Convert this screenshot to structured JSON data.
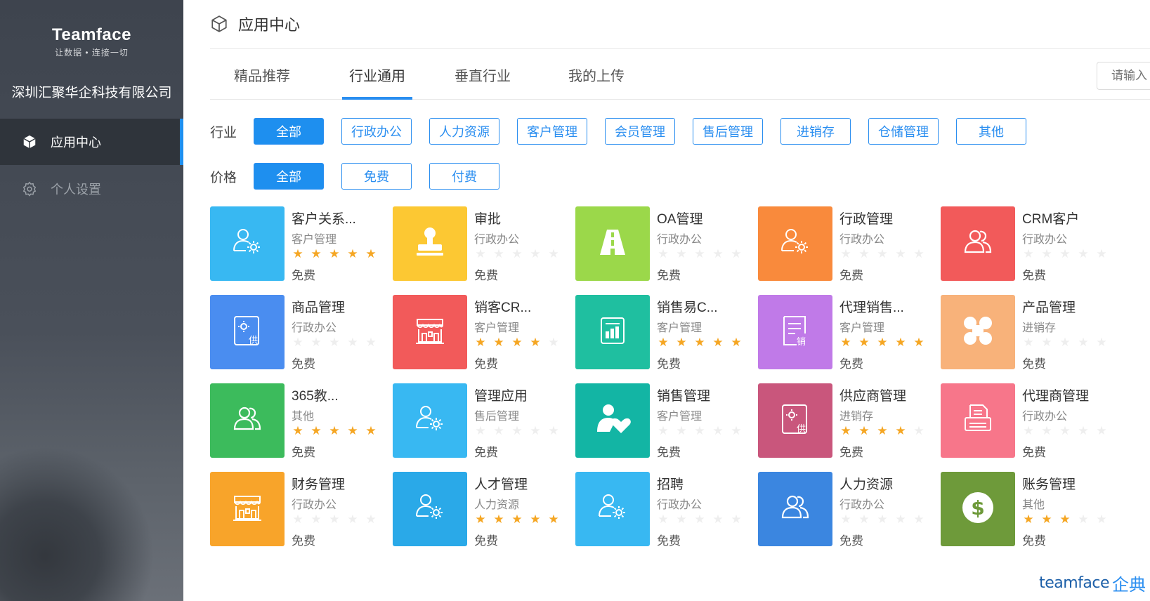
{
  "sidebar": {
    "logo_main": "Teamface",
    "logo_sub": "让数据 • 连接一切",
    "company": "深圳汇聚华企科技有限公司",
    "nav": [
      {
        "label": "应用中心",
        "icon": "cube-icon",
        "active": true
      },
      {
        "label": "个人设置",
        "icon": "gear-icon",
        "active": false
      }
    ]
  },
  "header": {
    "title": "应用中心",
    "icon": "cube-icon"
  },
  "tabs": [
    {
      "label": "精品推荐",
      "active": false
    },
    {
      "label": "行业通用",
      "active": true
    },
    {
      "label": "垂直行业",
      "active": false
    },
    {
      "label": "我的上传",
      "active": false
    }
  ],
  "search": {
    "placeholder": "请输入"
  },
  "filters": {
    "industry": {
      "label": "行业",
      "options": [
        "全部",
        "行政办公",
        "人力资源",
        "客户管理",
        "会员管理",
        "售后管理",
        "进销存",
        "仓储管理",
        "其他"
      ],
      "selected": "全部"
    },
    "price": {
      "label": "价格",
      "options": [
        "全部",
        "免费",
        "付费"
      ],
      "selected": "全部"
    }
  },
  "apps": [
    {
      "name": "客户关系...",
      "category": "客户管理",
      "rating": 5,
      "price": "免费",
      "color": "#38b8f2",
      "icon": "user-gear-icon"
    },
    {
      "name": "审批",
      "category": "行政办公",
      "rating": 0,
      "price": "免费",
      "color": "#fcc833",
      "icon": "stamp-icon"
    },
    {
      "name": "OA管理",
      "category": "行政办公",
      "rating": 0,
      "price": "免费",
      "color": "#9bd84a",
      "icon": "road-icon"
    },
    {
      "name": "行政管理",
      "category": "行政办公",
      "rating": 0,
      "price": "免费",
      "color": "#f98a3c",
      "icon": "user-gear-icon"
    },
    {
      "name": "CRM客户",
      "category": "行政办公",
      "rating": 0,
      "price": "免费",
      "color": "#f25a5a",
      "icon": "users-icon"
    },
    {
      "name": "商品管理",
      "category": "行政办公",
      "rating": 0,
      "price": "免费",
      "color": "#4a8df0",
      "icon": "supply-doc-icon"
    },
    {
      "name": "销客CR...",
      "category": "客户管理",
      "rating": 4,
      "price": "免费",
      "color": "#f25a5a",
      "icon": "store-icon"
    },
    {
      "name": "销售易C...",
      "category": "客户管理",
      "rating": 5,
      "price": "免费",
      "color": "#1fbfa0",
      "icon": "report-icon"
    },
    {
      "name": "代理销售...",
      "category": "客户管理",
      "rating": 5,
      "price": "免费",
      "color": "#c07ae8",
      "icon": "sales-doc-icon"
    },
    {
      "name": "产品管理",
      "category": "进销存",
      "rating": 0,
      "price": "免费",
      "color": "#f8b27a",
      "icon": "clover-icon"
    },
    {
      "name": "365教...",
      "category": "其他",
      "rating": 5,
      "price": "免费",
      "color": "#3cbb5c",
      "icon": "users-icon"
    },
    {
      "name": "管理应用",
      "category": "售后管理",
      "rating": 0,
      "price": "免费",
      "color": "#38b8f2",
      "icon": "user-gear-icon"
    },
    {
      "name": "销售管理",
      "category": "客户管理",
      "rating": 0,
      "price": "免费",
      "color": "#13b5a4",
      "icon": "user-heart-icon"
    },
    {
      "name": "供应商管理",
      "category": "进销存",
      "rating": 4,
      "price": "免费",
      "color": "#c9567c",
      "icon": "supply-doc-icon"
    },
    {
      "name": "代理商管理",
      "category": "行政办公",
      "rating": 0,
      "price": "免费",
      "color": "#f7768a",
      "icon": "printer-icon"
    },
    {
      "name": "财务管理",
      "category": "行政办公",
      "rating": 0,
      "price": "免费",
      "color": "#f8a42a",
      "icon": "store-icon"
    },
    {
      "name": "人才管理",
      "category": "人力资源",
      "rating": 5,
      "price": "免费",
      "color": "#2aa9e8",
      "icon": "user-gear-icon"
    },
    {
      "name": "招聘",
      "category": "行政办公",
      "rating": 0,
      "price": "免费",
      "color": "#38b8f2",
      "icon": "user-gear-icon"
    },
    {
      "name": "人力资源",
      "category": "行政办公",
      "rating": 0,
      "price": "免费",
      "color": "#3b86e0",
      "icon": "users-icon"
    },
    {
      "name": "账务管理",
      "category": "其他",
      "rating": 3,
      "price": "免费",
      "color": "#6e9a3a",
      "icon": "dollar-icon"
    }
  ],
  "watermark": {
    "brand": "teamface",
    "brand_cn": "企典"
  }
}
